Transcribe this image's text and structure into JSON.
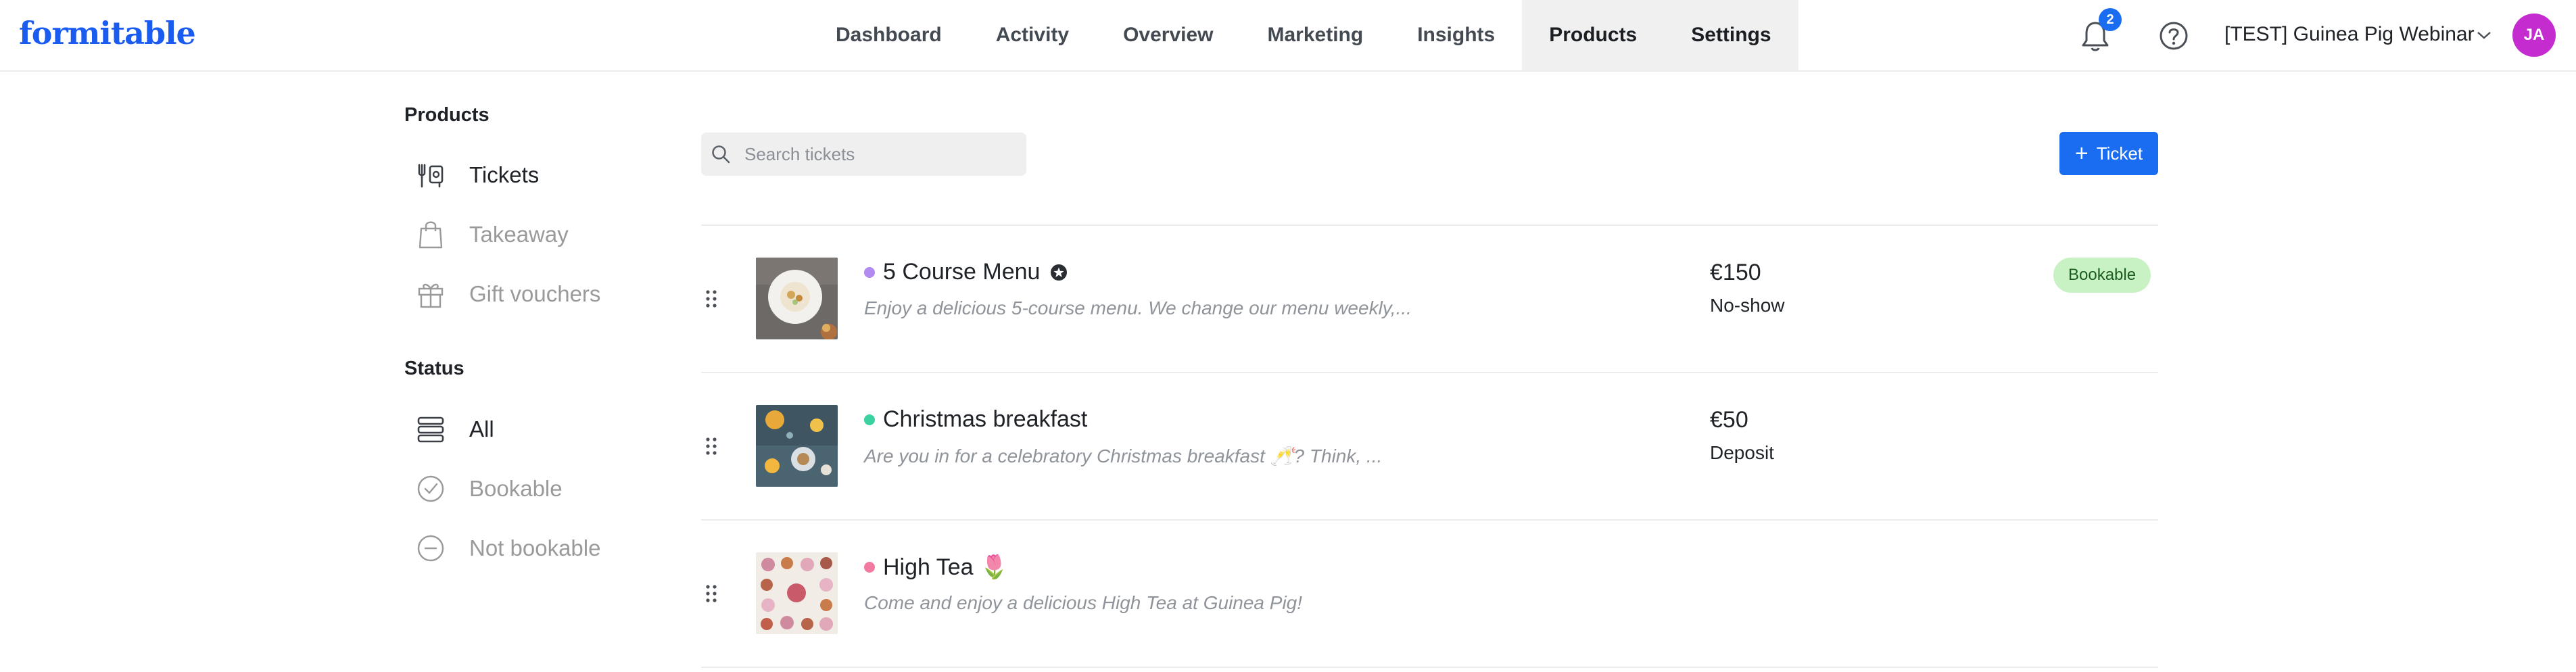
{
  "header": {
    "logo": "formitable",
    "nav": [
      {
        "label": "Dashboard"
      },
      {
        "label": "Activity"
      },
      {
        "label": "Overview"
      },
      {
        "label": "Marketing"
      },
      {
        "label": "Insights"
      },
      {
        "label": "Products"
      },
      {
        "label": "Settings"
      }
    ],
    "active_nav": "Products",
    "notification_count": "2",
    "org_name": "[TEST] Guinea Pig Webinar",
    "avatar_initials": "JA"
  },
  "sidebar": {
    "products_heading": "Products",
    "products": [
      {
        "label": "Tickets",
        "icon": "ticket-icon",
        "active": true
      },
      {
        "label": "Takeaway",
        "icon": "bag-icon",
        "active": false
      },
      {
        "label": "Gift vouchers",
        "icon": "gift-icon",
        "active": false
      }
    ],
    "status_heading": "Status",
    "statuses": [
      {
        "label": "All",
        "icon": "stack-icon",
        "active": true
      },
      {
        "label": "Bookable",
        "icon": "check-circle-icon",
        "active": false
      },
      {
        "label": "Not bookable",
        "icon": "minus-circle-icon",
        "active": false
      }
    ]
  },
  "toolbar": {
    "search_placeholder": "Search tickets",
    "search_value": "",
    "add_button_label": "Ticket"
  },
  "tickets": [
    {
      "name": "5 Course Menu",
      "dot_color": "#b28bf0",
      "has_star_badge": true,
      "description": "Enjoy a delicious 5-course menu.  We change our menu weekly,...",
      "price": "€150",
      "price_type": "No-show",
      "status": "Bookable"
    },
    {
      "name": "Christmas breakfast",
      "dot_color": "#3cd1a0",
      "has_star_badge": false,
      "description": "Are you in for a celebratory Christmas breakfast 🥂? Think, ...",
      "price": "€50",
      "price_type": "Deposit",
      "status": ""
    },
    {
      "name": "High Tea 🌷",
      "dot_color": "#f27aa0",
      "has_star_badge": false,
      "description": "Come and enjoy a delicious High Tea at Guinea Pig!",
      "price": "",
      "price_type": "",
      "status": ""
    }
  ],
  "colors": {
    "brand": "#1a5bf0",
    "primary_button": "#1a6cf0",
    "avatar": "#c42ccf",
    "bookable_pill": "#c8f2c4"
  }
}
